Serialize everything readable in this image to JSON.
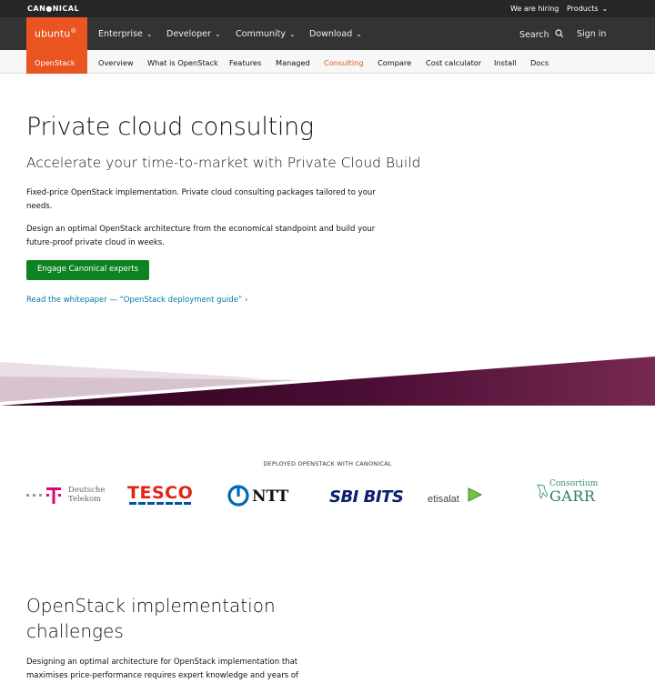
{
  "topbar": {
    "brand": "CAN●NICAL",
    "hiring": "We are hiring",
    "products": "Products"
  },
  "nav": {
    "logo": "ubuntu",
    "logo_mark": "®",
    "items": [
      {
        "label": "Enterprise"
      },
      {
        "label": "Developer"
      },
      {
        "label": "Community"
      },
      {
        "label": "Download"
      }
    ],
    "search": "Search",
    "signin": "Sign in"
  },
  "subnav": {
    "section": "OpenStack",
    "items": [
      {
        "label": "Overview"
      },
      {
        "label": "What is OpenStack"
      },
      {
        "label": "Features"
      },
      {
        "label": "Managed"
      },
      {
        "label": "Consulting"
      },
      {
        "label": "Compare"
      },
      {
        "label": "Cost calculator"
      },
      {
        "label": "Install"
      },
      {
        "label": "Docs"
      }
    ],
    "active": "Consulting"
  },
  "hero": {
    "title": "Private cloud consulting",
    "subtitle": "Accelerate your time-to-market with Private Cloud Build",
    "p1": "Fixed-price OpenStack implementation. Private cloud consulting packages tailored to your needs.",
    "p2": "Design an optimal OpenStack architecture from the economical standpoint and build your future-proof private cloud in weeks.",
    "cta": "Engage Canonical experts",
    "link": "Read the whitepaper — “OpenStack deployment guide” ›"
  },
  "logos": {
    "heading": "DEPLOYED OPENSTACK WITH CANONICAL",
    "dt_line1": "Deutsche",
    "dt_line2": "Telekom",
    "tesco": "TESCO",
    "ntt": "NTT",
    "sbi": "SBI BITS",
    "etisalat": "etisalat",
    "garr_line1": "Consortium",
    "garr_line2": "GARR"
  },
  "challenges": {
    "title": "OpenStack implementation challenges",
    "p1": "Designing an optimal architecture for OpenStack implementation that maximises price-performance requires expert knowledge and years of"
  },
  "colors": {
    "orange": "#e95420",
    "green": "#0e8420",
    "aubergine": "#772953",
    "link": "#007aa6"
  }
}
